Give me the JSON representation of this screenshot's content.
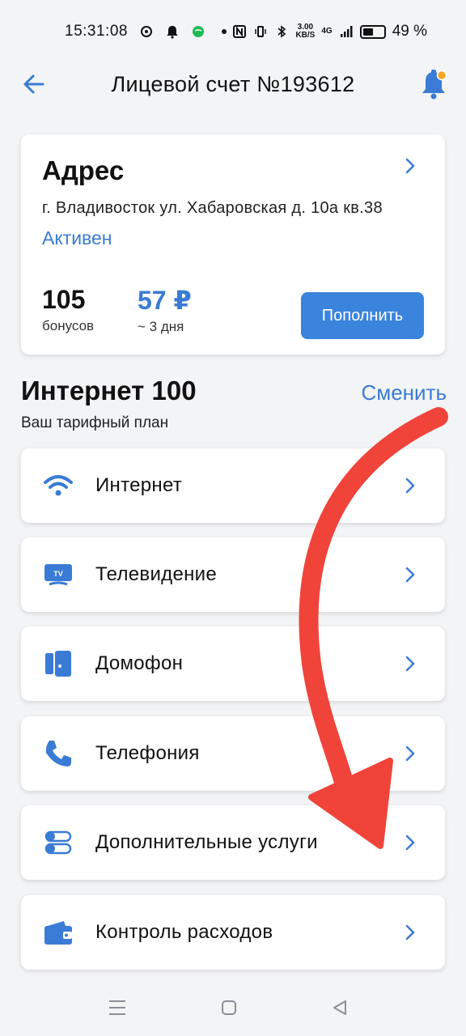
{
  "status_bar": {
    "time": "15:31:08",
    "speed_top": "3.00",
    "speed_bottom": "KB/S",
    "network": "4G",
    "battery": "49 %"
  },
  "header": {
    "title": "Лицевой счет №193612"
  },
  "account": {
    "address_title": "Адрес",
    "address_line": "г. Владивосток ул. Хабаровская д. 10а кв.38",
    "status": "Активен",
    "bonuses_value": "105",
    "bonuses_label": "бонусов",
    "balance_value": "57 ₽",
    "balance_label": "~ 3 дня",
    "topup_label": "Пополнить"
  },
  "tariff": {
    "name": "Интернет 100",
    "subtitle": "Ваш тарифный план",
    "change_label": "Сменить"
  },
  "services": [
    {
      "label": "Интернет",
      "icon": "wifi-icon"
    },
    {
      "label": "Телевидение",
      "icon": "tv-icon"
    },
    {
      "label": "Домофон",
      "icon": "intercom-icon"
    },
    {
      "label": "Телефония",
      "icon": "phone-icon"
    },
    {
      "label": "Дополнительные услуги",
      "icon": "toggles-icon"
    },
    {
      "label": "Контроль расходов",
      "icon": "wallet-icon"
    }
  ],
  "colors": {
    "accent": "#3a7bd5",
    "button": "#3a84dd",
    "background": "#f3f4f6",
    "annotation_arrow": "#f0443a"
  }
}
